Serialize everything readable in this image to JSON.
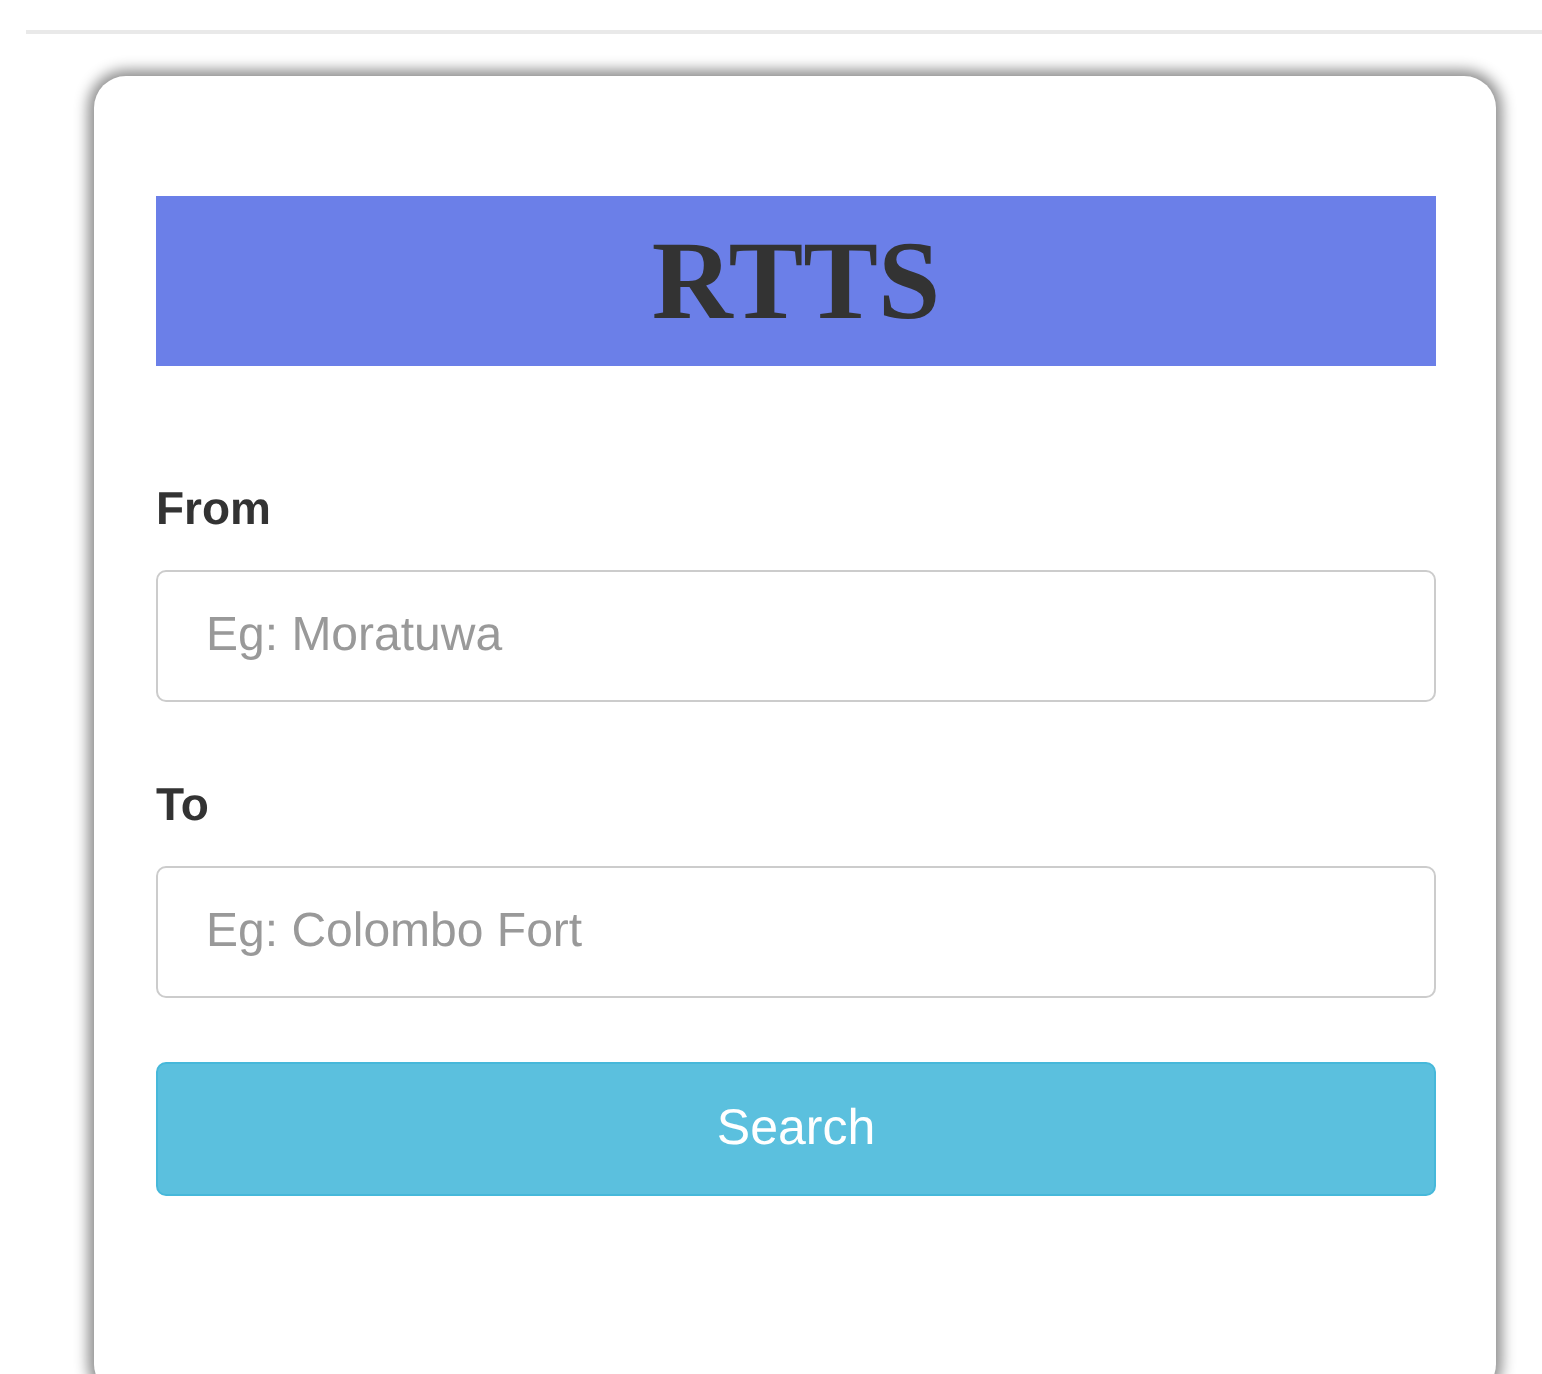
{
  "title": "RTTS",
  "fields": [
    {
      "label": "From",
      "placeholder": "Eg: Moratuwa"
    },
    {
      "label": "To",
      "placeholder": "Eg: Colombo Fort"
    }
  ],
  "button": "Search"
}
